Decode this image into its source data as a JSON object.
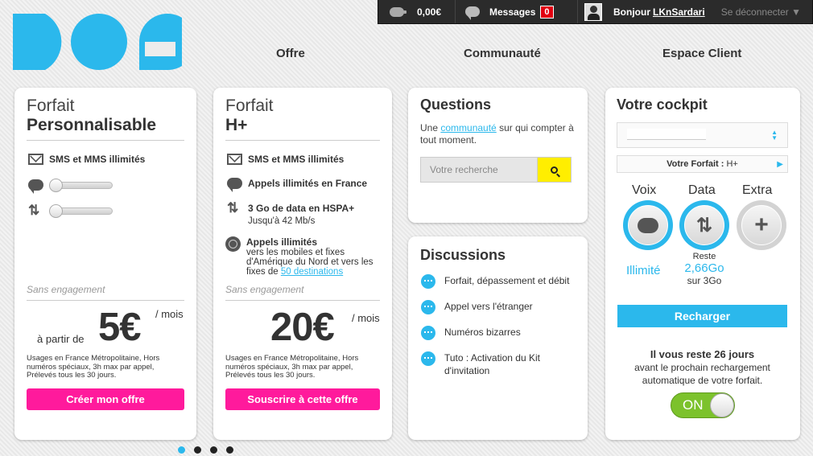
{
  "topbar": {
    "balance": "0,00€",
    "messages_label": "Messages",
    "messages_count": "0",
    "greeting": "Bonjour",
    "username": "LKnSardari",
    "logout": "Se déconnecter ▼"
  },
  "nav": {
    "items": [
      "Offre",
      "Communauté",
      "Espace Client"
    ]
  },
  "colors": {
    "brand_blue": "#2bb8ec",
    "pink": "#ff1a9c",
    "yellow": "#ffee00",
    "green": "#7cc22c"
  },
  "offer1": {
    "title_line1": "Forfait",
    "title_line2": "Personnalisable",
    "feature1": "SMS et MMS illimités",
    "sans_engagement": "Sans engagement",
    "price_prefix": "à partir de",
    "price": "5€",
    "price_suffix": "/ mois",
    "usages": "Usages en France Métropolitaine, Hors numéros spéciaux, 3h max par appel, Prélevés tous les 30 jours.",
    "button": "Créer mon offre"
  },
  "offer2": {
    "title_line1": "Forfait",
    "title_line2": "H+",
    "feature1": "SMS et MMS illimités",
    "feature2": "Appels illimités en France",
    "feature3": "3 Go de data en HSPA+",
    "feature3_sub": "Jusqu'à 42 Mb/s",
    "feature4": "Appels illimités",
    "feature4_sub": "vers les mobiles et fixes d'Amérique du Nord et vers les fixes de",
    "feature4_link": "50 destinations",
    "sans_engagement": "Sans engagement",
    "price": "20€",
    "price_suffix": "/ mois",
    "usages": "Usages en France Métropolitaine, Hors numéros spéciaux, 3h max par appel, Prélevés tous les 30 jours.",
    "button": "Souscrire à cette offre"
  },
  "questions": {
    "title": "Questions",
    "text_before": "Une",
    "link": "communauté",
    "text_after": "sur qui compter à tout moment.",
    "search_placeholder": "Votre recherche"
  },
  "discussions": {
    "title": "Discussions",
    "items": [
      "Forfait, dépassement et débit",
      "Appel vers l'étranger",
      "Numéros bizarres",
      "Tuto : Activation du Kit d'invitation"
    ]
  },
  "cockpit": {
    "title": "Votre cockpit",
    "forfait_label": "Votre Forfait :",
    "forfait_value": "H+",
    "voix_label": "Voix",
    "data_label": "Data",
    "extra_label": "Extra",
    "voix_value": "Illimité",
    "data_reste": "Reste",
    "data_value": "2,66Go",
    "data_total": "sur 3Go",
    "recharge_button": "Recharger",
    "days_left": "Il vous reste 26 jours",
    "days_text": "avant le prochain rechargement automatique de votre forfait.",
    "toggle_label": "ON"
  },
  "carousel": {
    "pages": 4,
    "active": 1
  }
}
